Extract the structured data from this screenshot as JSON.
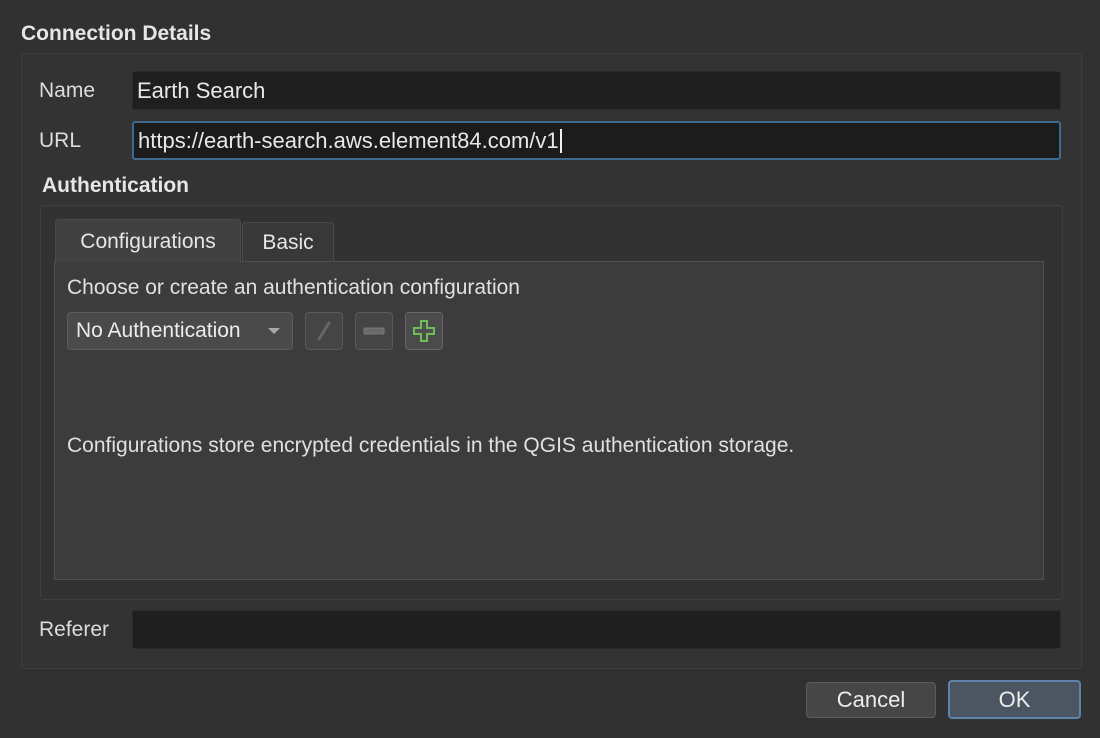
{
  "connection": {
    "title": "Connection Details",
    "name_label": "Name",
    "name_value": "Earth Search",
    "url_label": "URL",
    "url_value": "https://earth-search.aws.element84.com/v1",
    "referer_label": "Referer",
    "referer_value": ""
  },
  "authentication": {
    "title": "Authentication",
    "tabs": [
      {
        "label": "Configurations",
        "active": true
      },
      {
        "label": "Basic",
        "active": false
      }
    ],
    "choose_text": "Choose or create an authentication configuration",
    "combo_value": "No Authentication",
    "info_text": "Configurations store encrypted credentials in the QGIS authentication storage.",
    "tools": [
      {
        "icon": "pencil-icon",
        "enabled": false
      },
      {
        "icon": "minus-icon",
        "enabled": false
      },
      {
        "icon": "plus-icon",
        "enabled": true
      }
    ]
  },
  "buttons": {
    "cancel": "Cancel",
    "ok": "OK"
  },
  "colors": {
    "background": "#313131",
    "field_bg": "#1f1f1f",
    "focus_border": "#3e6a90",
    "ok_border": "#5e84ab",
    "plus_icon": "#6bbf59"
  }
}
